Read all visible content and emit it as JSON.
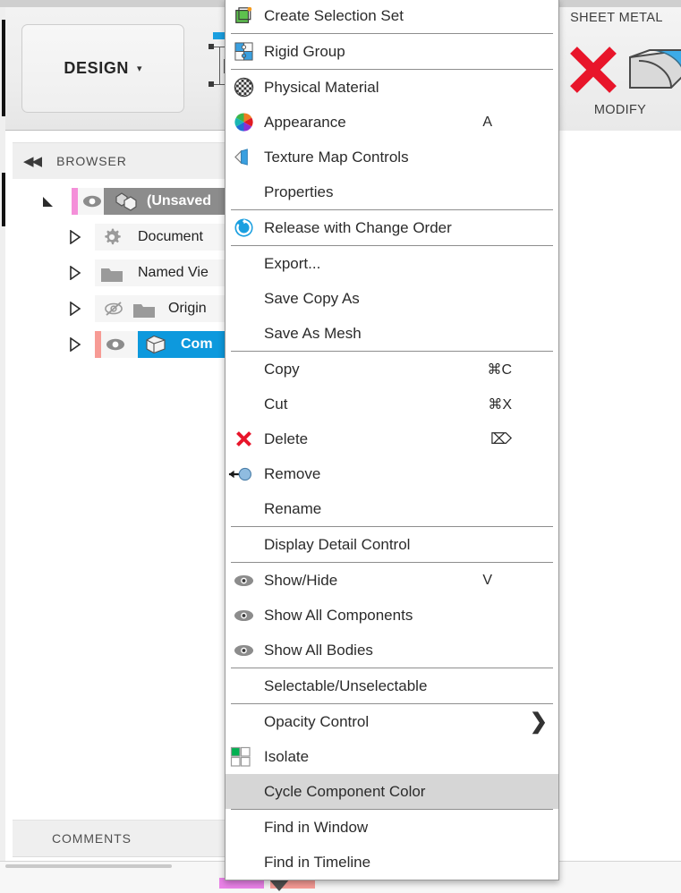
{
  "app": {
    "ribbon": {
      "design_button": "DESIGN",
      "design_caret": "▾",
      "sheet_metal_tab": "SHEET METAL",
      "modify_label": "MODIFY"
    },
    "browser": {
      "title": "BROWSER",
      "collapse_icon": "◀◀",
      "items": [
        {
          "label": "(Unsaved",
          "indent": 0,
          "selected": false,
          "dark": true,
          "eye": "visible",
          "icon": "component-icon",
          "bar": "#f07ad0"
        },
        {
          "label": "Document",
          "indent": 1,
          "selected": false,
          "dark": false,
          "eye": "none",
          "icon": "gear-icon",
          "bar": ""
        },
        {
          "label": "Named Vie",
          "indent": 1,
          "selected": false,
          "dark": false,
          "eye": "none",
          "icon": "folder-icon",
          "bar": ""
        },
        {
          "label": "Origin",
          "indent": 1,
          "selected": false,
          "dark": false,
          "eye": "hidden",
          "icon": "folder-icon",
          "bar": ""
        },
        {
          "label": "Com",
          "indent": 1,
          "selected": true,
          "dark": false,
          "eye": "visible",
          "icon": "body-icon",
          "bar": "#f79b95"
        }
      ]
    },
    "comments": {
      "label": "COMMENTS"
    }
  },
  "context_menu": {
    "items": [
      {
        "label": "Create Selection Set",
        "icon": "selection-set-icon",
        "shortcut": "",
        "separator_after": true,
        "highlight": false,
        "submenu": false
      },
      {
        "label": "Rigid Group",
        "icon": "rigid-group-icon",
        "shortcut": "",
        "separator_after": true,
        "highlight": false,
        "submenu": false
      },
      {
        "label": "Physical Material",
        "icon": "physical-material-icon",
        "shortcut": "",
        "separator_after": false,
        "highlight": false,
        "submenu": false
      },
      {
        "label": "Appearance",
        "icon": "appearance-icon",
        "shortcut": "A",
        "separator_after": false,
        "highlight": false,
        "submenu": false
      },
      {
        "label": "Texture Map Controls",
        "icon": "texture-map-icon",
        "shortcut": "",
        "separator_after": false,
        "highlight": false,
        "submenu": false
      },
      {
        "label": "Properties",
        "icon": "",
        "shortcut": "",
        "separator_after": true,
        "highlight": false,
        "submenu": false
      },
      {
        "label": "Release with Change Order",
        "icon": "release-change-order-icon",
        "shortcut": "",
        "separator_after": true,
        "highlight": false,
        "submenu": false
      },
      {
        "label": "Export...",
        "icon": "",
        "shortcut": "",
        "separator_after": false,
        "highlight": false,
        "submenu": false
      },
      {
        "label": "Save Copy As",
        "icon": "",
        "shortcut": "",
        "separator_after": false,
        "highlight": false,
        "submenu": false
      },
      {
        "label": "Save As Mesh",
        "icon": "",
        "shortcut": "",
        "separator_after": true,
        "highlight": false,
        "submenu": false
      },
      {
        "label": "Copy",
        "icon": "",
        "shortcut": "⌘C",
        "separator_after": false,
        "highlight": false,
        "submenu": false
      },
      {
        "label": "Cut",
        "icon": "",
        "shortcut": "⌘X",
        "separator_after": false,
        "highlight": false,
        "submenu": false
      },
      {
        "label": "Delete",
        "icon": "delete-icon",
        "shortcut": "⌦",
        "separator_after": false,
        "highlight": false,
        "submenu": false
      },
      {
        "label": "Remove",
        "icon": "remove-icon",
        "shortcut": "",
        "separator_after": false,
        "highlight": false,
        "submenu": false
      },
      {
        "label": "Rename",
        "icon": "",
        "shortcut": "",
        "separator_after": true,
        "highlight": false,
        "submenu": false
      },
      {
        "label": "Display Detail Control",
        "icon": "",
        "shortcut": "",
        "separator_after": true,
        "highlight": false,
        "submenu": false
      },
      {
        "label": "Show/Hide",
        "icon": "eye-icon",
        "shortcut": "V",
        "separator_after": false,
        "highlight": false,
        "submenu": false
      },
      {
        "label": "Show All Components",
        "icon": "eye-icon",
        "shortcut": "",
        "separator_after": false,
        "highlight": false,
        "submenu": false
      },
      {
        "label": "Show All Bodies",
        "icon": "eye-icon",
        "shortcut": "",
        "separator_after": true,
        "highlight": false,
        "submenu": false
      },
      {
        "label": "Selectable/Unselectable",
        "icon": "",
        "shortcut": "",
        "separator_after": true,
        "highlight": false,
        "submenu": false
      },
      {
        "label": "Opacity Control",
        "icon": "",
        "shortcut": "",
        "separator_after": false,
        "highlight": false,
        "submenu": true
      },
      {
        "label": "Isolate",
        "icon": "isolate-icon",
        "shortcut": "",
        "separator_after": false,
        "highlight": false,
        "submenu": false
      },
      {
        "label": "Cycle Component Color",
        "icon": "",
        "shortcut": "",
        "separator_after": true,
        "highlight": true,
        "submenu": false
      },
      {
        "label": "Find in Window",
        "icon": "",
        "shortcut": "",
        "separator_after": false,
        "highlight": false,
        "submenu": false
      },
      {
        "label": "Find in Timeline",
        "icon": "",
        "shortcut": "",
        "separator_after": false,
        "highlight": false,
        "submenu": false
      }
    ],
    "submenu_arrow": "❯"
  },
  "colors": {
    "highlight_row": "#d6d6d6",
    "selected_tree_row": "#0d99dd",
    "delete_red": "#e01b22",
    "link_blue": "#1a9fe0",
    "isolate_green": "#00b050"
  }
}
